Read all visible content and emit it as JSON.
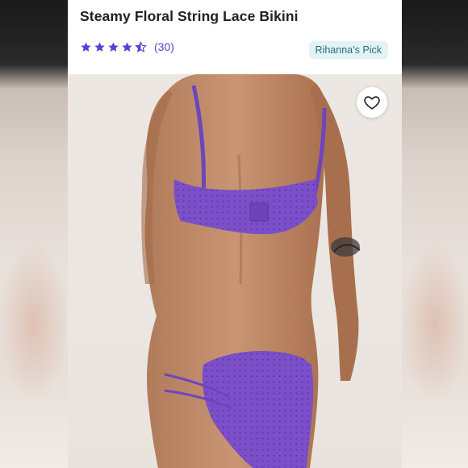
{
  "product": {
    "title": "Steamy Floral String Lace Bikini",
    "rating": 4.5,
    "review_count": "(30)",
    "badge": "Rihanna’s Pick"
  },
  "colors": {
    "star": "#5b3fd1",
    "badge_bg": "#e2f3f5",
    "badge_text": "#2b6d78",
    "garment": "#7a4fc8"
  },
  "icons": {
    "wishlist": "heart-outline-icon",
    "rating": "star-icon"
  }
}
